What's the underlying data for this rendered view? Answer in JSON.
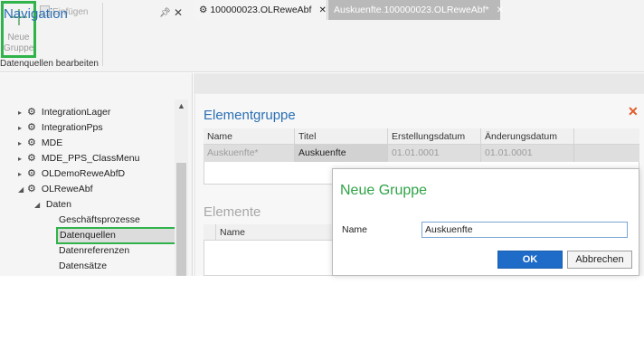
{
  "ribbon": {
    "new_group_label": "Neue Gruppe",
    "paste_label": "Einfügen",
    "group_label": "Datenquellen bearbeiten"
  },
  "navigation": {
    "title": "Navigation",
    "pin_icon": "pin-icon",
    "items": [
      {
        "label": "IntegrationLager"
      },
      {
        "label": "IntegrationPps"
      },
      {
        "label": "MDE"
      },
      {
        "label": "MDE_PPS_ClassMenu"
      },
      {
        "label": "OLDemoReweAbfD"
      },
      {
        "label": "OLReweAbf"
      },
      {
        "label": "Daten"
      },
      {
        "label": "Geschäftsprozesse"
      },
      {
        "label": "Datenquellen"
      },
      {
        "label": "Datenreferenzen"
      },
      {
        "label": "Datensätze"
      }
    ]
  },
  "tabs": [
    {
      "label": "100000023.OLReweAbf"
    },
    {
      "label": "Auskuenfte.100000023.OLReweAbf*"
    }
  ],
  "document": {
    "elementgruppe_title": "Elementgruppe",
    "columns": [
      "Name",
      "Titel",
      "Erstellungsdatum",
      "Änderungsdatum"
    ],
    "row": [
      "Auskuenfte*",
      "Auskuenfte",
      "01.01.0001",
      "01.01.0001"
    ],
    "elemente_title": "Elemente",
    "elemente_columns": [
      "Name"
    ]
  },
  "dialog": {
    "title": "Neue Gruppe",
    "name_label": "Name",
    "name_value": "Auskuenfte",
    "ok_label": "OK",
    "cancel_label": "Abbrechen"
  },
  "colors": {
    "highlight_green": "#2fb34a",
    "title_blue": "#2b6fb3",
    "primary_button": "#1e6cc8"
  }
}
